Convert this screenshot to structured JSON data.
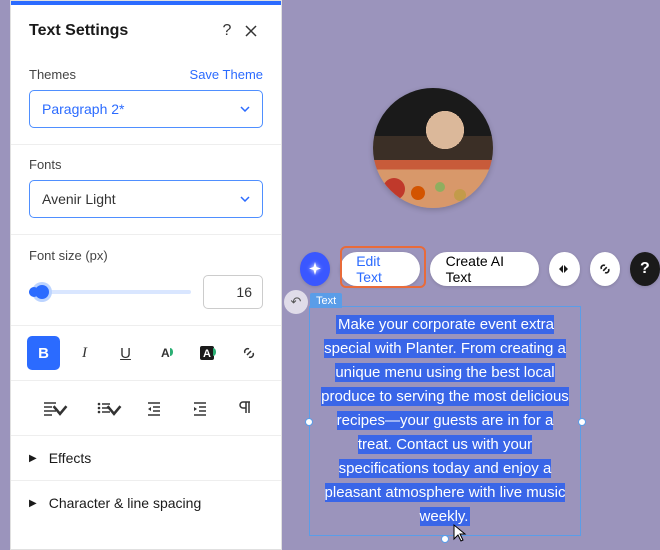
{
  "panel": {
    "title": "Text Settings",
    "themes": {
      "label": "Themes",
      "save": "Save Theme",
      "value": "Paragraph 2*"
    },
    "fonts": {
      "label": "Fonts",
      "value": "Avenir Light"
    },
    "fontsize": {
      "label": "Font size (px)",
      "value": "16"
    },
    "effects": "Effects",
    "charspacing": "Character & line spacing"
  },
  "toolbar": {
    "edit_text": "Edit Text",
    "create_ai": "Create AI Text"
  },
  "textblock": {
    "tag": "Text",
    "content": "Make your corporate event extra special with Planter. From creating a unique menu using the best local produce to serving the most delicious recipes—your guests are in for a treat. Contact us with your specifications today and enjoy a pleasant atmosphere with live music weekly."
  },
  "colors": {
    "accent": "#2b6bff",
    "highlight_border": "#e86b3a",
    "selection_border": "#5a9de8",
    "text_highlight": "#3a66e8"
  }
}
